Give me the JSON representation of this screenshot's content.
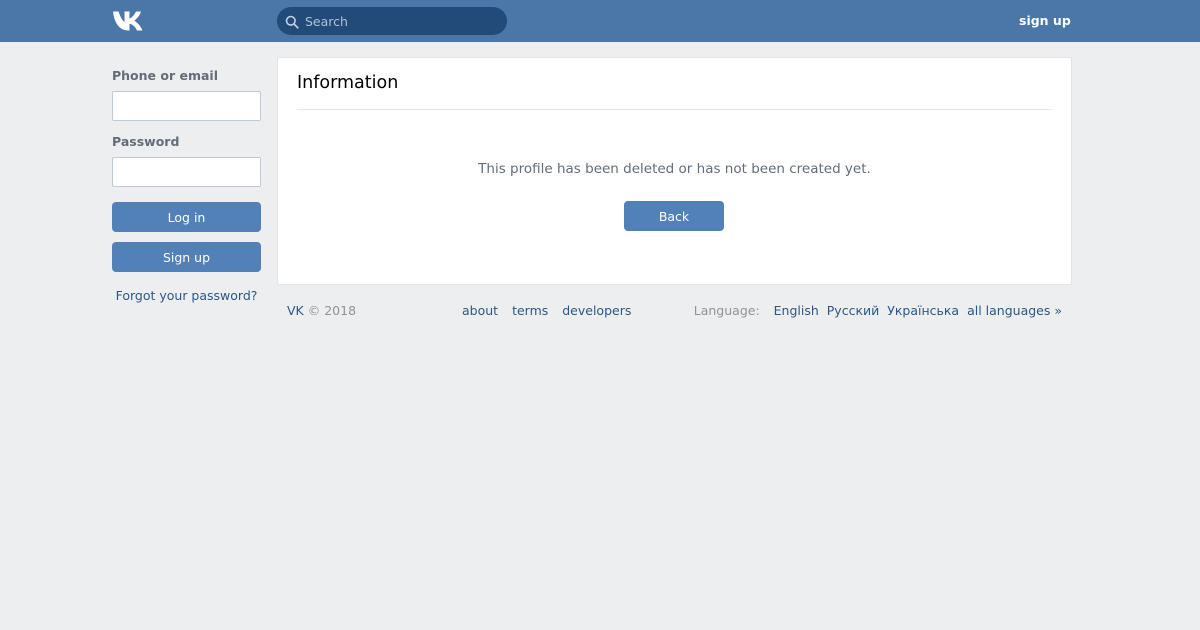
{
  "header": {
    "logo_icon": "vk-logo-icon",
    "search": {
      "placeholder": "Search",
      "value": "",
      "icon": "search-icon"
    },
    "signup_link": "sign up"
  },
  "login": {
    "phone_label": "Phone or email",
    "phone_value": "",
    "password_label": "Password",
    "password_value": "",
    "login_button": "Log in",
    "signup_button": "Sign up",
    "forgot_link": "Forgot your password?"
  },
  "panel": {
    "title": "Information",
    "message": "This profile has been deleted or has not been created yet.",
    "back_button": "Back"
  },
  "footer": {
    "brand": "VK",
    "copyright": "© 2018",
    "links": [
      "about",
      "terms",
      "developers"
    ],
    "language_label": "Language:",
    "languages": [
      "English",
      "Русский",
      "Українська",
      "all languages »"
    ]
  },
  "colors": {
    "header_bg": "#4a76a8",
    "page_bg": "#edeef0",
    "button_bg": "#5181b8",
    "link": "#2a5885"
  }
}
